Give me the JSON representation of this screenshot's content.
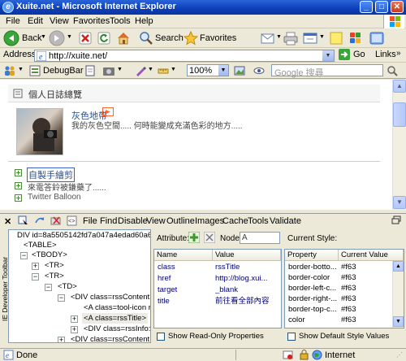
{
  "window": {
    "title": "Xuite.net - Microsoft Internet Explorer"
  },
  "menu": [
    "File",
    "Edit",
    "View",
    "Favorites",
    "Tools",
    "Help"
  ],
  "toolbar": {
    "back": "Back",
    "search": "Search",
    "favorites": "Favorites"
  },
  "address": {
    "label": "Address",
    "url": "http://xuite.net/",
    "go": "Go",
    "links": "Links"
  },
  "devbar": {
    "debugbar": "DebugBar",
    "zoom": "100%",
    "search_placeholder": "Google 搜尋"
  },
  "page": {
    "section_title": "個人日誌總覽",
    "author": "灰色地帶",
    "description": "我的灰色空間..... 何時能變成充滿色彩的地方.....",
    "posts": [
      "自製手繪剪",
      "來電答鈴被鎌藥了......",
      "Twitter Balloon"
    ]
  },
  "devtools": {
    "menu": [
      "File",
      "Find",
      "Disable",
      "View",
      "Outline",
      "Images",
      "Cache",
      "Tools",
      "Validate"
    ],
    "side_label": "IE Developer Toolbar",
    "tree": [
      "DIV id=8a5505142fd7a047a4edad60a69b",
      "<TABLE>",
      "<TBODY>",
      "<TR>",
      "<TR>",
      "<TD>",
      "<DIV class=rssContent>",
      "<A class=tool-icon r",
      "<A class=rssTitle>",
      "<DIV class=rssInfo:",
      "<DIV class=rssContent"
    ],
    "attribute": {
      "label": "Attribute:",
      "node_label": "Node:",
      "node_value": "A",
      "columns": [
        "Name",
        "Value"
      ],
      "rows": [
        {
          "name": "class",
          "value": "rssTitle"
        },
        {
          "name": "href",
          "value": "http://blog.xui..."
        },
        {
          "name": "target",
          "value": "_blank"
        },
        {
          "name": "title",
          "value": "前往看全部內容"
        }
      ],
      "show_readonly": "Show Read-Only Properties"
    },
    "style": {
      "label": "Current Style:",
      "columns": [
        "Property",
        "Current Value"
      ],
      "rows": [
        {
          "property": "border-botto...",
          "value": "#f63"
        },
        {
          "property": "border-color",
          "value": "#f63"
        },
        {
          "property": "border-left-c...",
          "value": "#f63"
        },
        {
          "property": "border-right-...",
          "value": "#f63"
        },
        {
          "property": "border-top-c...",
          "value": "#f63"
        },
        {
          "property": "color",
          "value": "#f63"
        }
      ],
      "show_default": "Show Default Style Values"
    }
  },
  "status": {
    "left": "Done",
    "zone": "Internet"
  },
  "colors": {
    "titlebar": "#0b3fb8",
    "link": "#2b4f8f",
    "attr_value": "#00007b"
  }
}
